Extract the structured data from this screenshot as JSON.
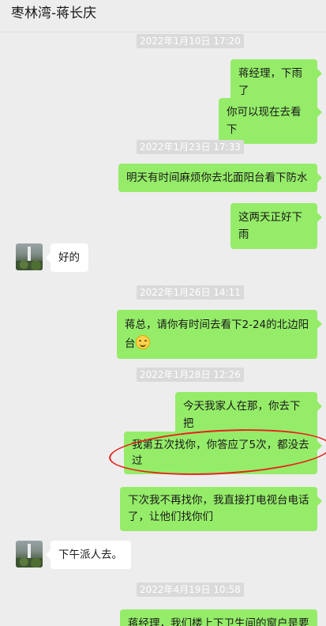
{
  "header": {
    "title": "枣林湾-蒋长庆"
  },
  "messages": [
    {
      "type": "time",
      "text": "2022年1月10日 17:20"
    },
    {
      "type": "out",
      "text": "蒋经理，下雨了"
    },
    {
      "type": "out",
      "text": "你可以现在去看下"
    },
    {
      "type": "time",
      "text": "2022年1月23日 17:33"
    },
    {
      "type": "out",
      "text": "明天有时间麻烦你去北面阳台看下防水"
    },
    {
      "type": "out",
      "text": "这两天正好下雨"
    },
    {
      "type": "in",
      "text": "好的"
    },
    {
      "type": "time",
      "text": "2022年1月26日 14:11"
    },
    {
      "type": "out",
      "text": "蒋总，请你有时间去看下2-24的北边阳台",
      "emoji": "smile-emoji"
    },
    {
      "type": "time",
      "text": "2022年1月28日 12:26"
    },
    {
      "type": "out",
      "text": "今天我家人在那，你去下把"
    },
    {
      "type": "out",
      "text": "我第五次找你，你答应了5次，都没去过"
    },
    {
      "type": "out",
      "text": "下次我不再找你，我直接打电视台电话了，让他们找你们"
    },
    {
      "type": "in",
      "text": "下午派人去。"
    },
    {
      "type": "time",
      "text": "2022年4月19日 10:58"
    },
    {
      "type": "out",
      "text": "蒋经理，我们楼上下卫生间的窗户是要"
    }
  ],
  "colors": {
    "outgoing": "#95ec69",
    "incoming": "#ffffff",
    "background": "#ededed",
    "annotation": "#e8211c"
  }
}
